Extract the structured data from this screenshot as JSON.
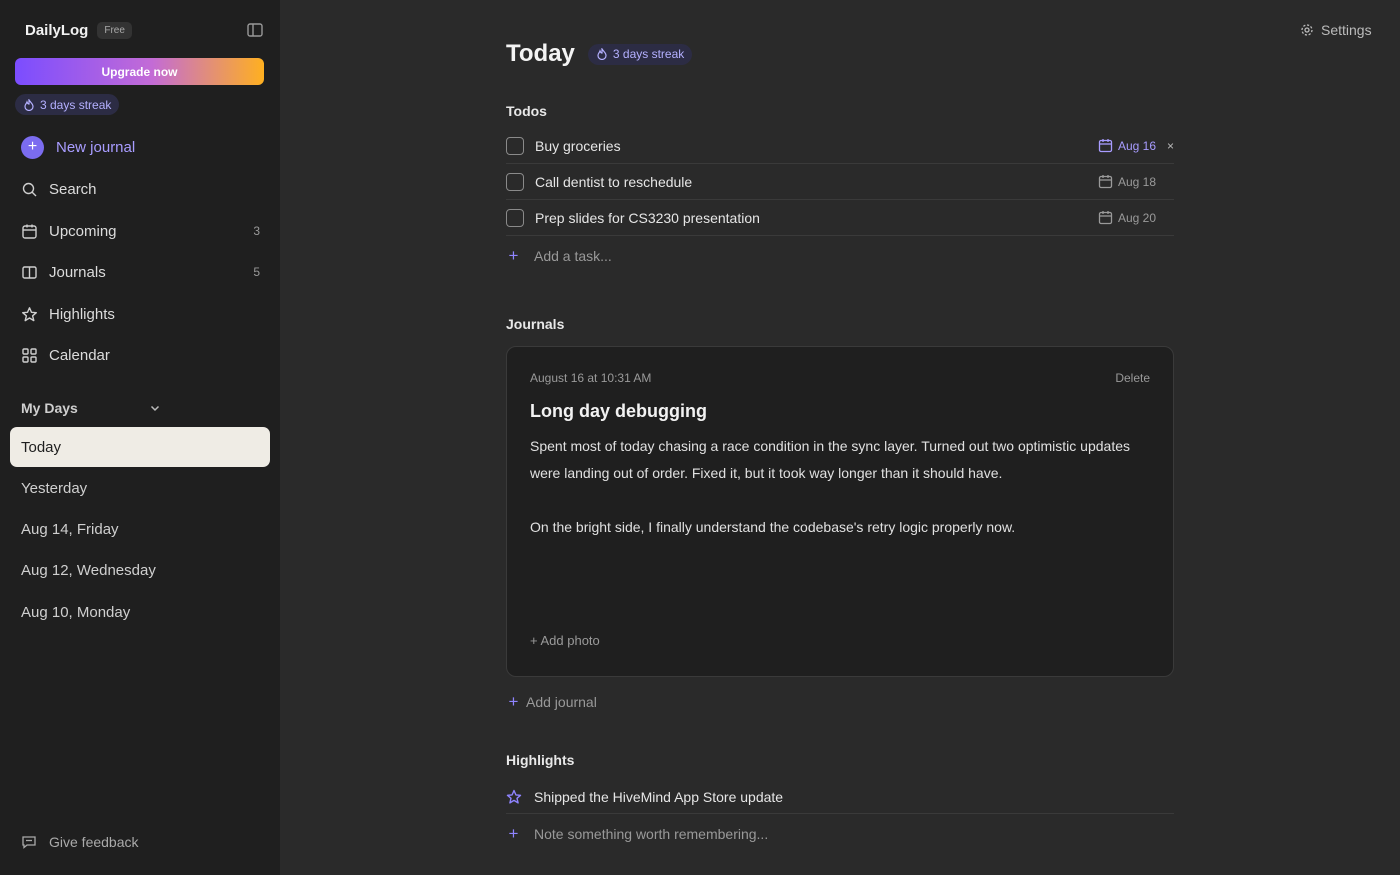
{
  "app": {
    "name": "DailyLog",
    "plan": "Free"
  },
  "sidebar": {
    "upgrade_label": "Upgrade now",
    "streak": "3 days streak",
    "new_journal": "New journal",
    "nav": [
      {
        "label": "Search",
        "count": ""
      },
      {
        "label": "Upcoming",
        "count": "3"
      },
      {
        "label": "Journals",
        "count": "5"
      },
      {
        "label": "Highlights",
        "count": ""
      },
      {
        "label": "Calendar",
        "count": ""
      }
    ],
    "section_title": "My Days",
    "days": [
      "Today",
      "Yesterday",
      "Aug 14, Friday",
      "Aug 12, Wednesday",
      "Aug 10, Monday"
    ],
    "feedback": "Give feedback"
  },
  "header": {
    "settings": "Settings"
  },
  "main": {
    "title": "Today",
    "streak": "3 days streak",
    "todos_title": "Todos",
    "todos": [
      {
        "text": "Buy groceries",
        "date": "Aug 16"
      },
      {
        "text": "Call dentist to reschedule",
        "date": "Aug 18"
      },
      {
        "text": "Prep slides for CS3230 presentation",
        "date": "Aug 20"
      }
    ],
    "todo_remove": "×",
    "add_task": "Add a task...",
    "journals_title": "Journals",
    "journal": {
      "time": "August 16 at 10:31 AM",
      "delete": "Delete",
      "title": "Long day debugging",
      "para1": "Spent most of today chasing a race condition in the sync layer. Turned out two optimistic updates were landing out of order. Fixed it, but it took way longer than it should have.",
      "para2": "On the bright side, I finally understand the codebase's retry logic properly now.",
      "add_photo": "+ Add photo"
    },
    "add_journal": "Add journal",
    "highlights_title": "Highlights",
    "highlight": "Shipped the HiveMind App Store update",
    "add_highlight": "Note something worth remembering..."
  },
  "colors": {
    "accent": "#8f84ff",
    "sidebar_bg": "#1f1f1f",
    "main_bg": "#2a2a2a",
    "active_day": "#efece5"
  },
  "icons": [
    "sidebar-toggle-icon",
    "flame-icon",
    "search-icon",
    "calendar-icon",
    "book-icon",
    "star-icon",
    "grid-icon",
    "chevron-down-icon",
    "message-icon",
    "gear-icon"
  ]
}
